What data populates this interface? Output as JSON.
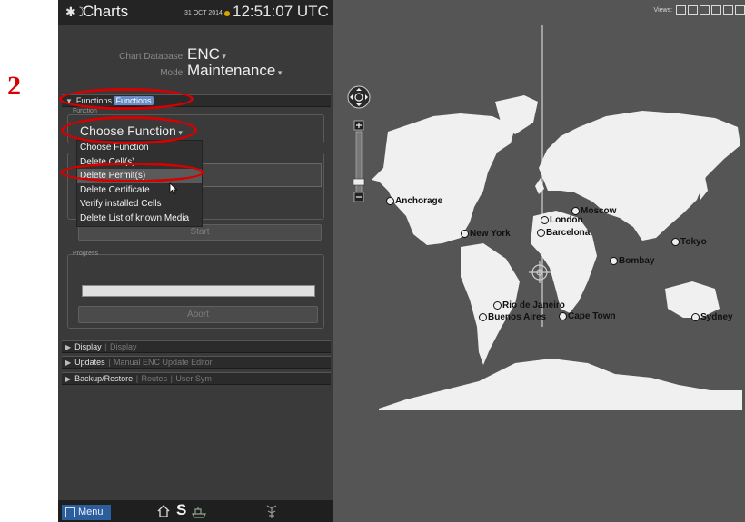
{
  "annotations": {
    "num2": "2",
    "num3": "3"
  },
  "header": {
    "title": "Charts",
    "date": "31 OCT 2014",
    "time": "12:51:07 UTC",
    "status_color": "#d7a400"
  },
  "settings": {
    "chart_database_label": "Chart Database:",
    "chart_database_value": "ENC",
    "mode_label": "Mode:",
    "mode_value": "Maintenance"
  },
  "sections": {
    "functions": {
      "label": "Functions",
      "sub": "Functions"
    },
    "display": {
      "label": "Display",
      "sub": "Display"
    },
    "updates": {
      "label": "Updates",
      "sub": "Manual ENC Update Editor"
    },
    "backup": {
      "label": "Backup/Restore",
      "sub1": "Routes",
      "sub2": "User Sym"
    }
  },
  "function_panel": {
    "group_label": "Function",
    "selected": "Choose Function",
    "options": [
      "Choose Function",
      "Delete Cell(s)",
      "Delete Permit(s)",
      "Delete Certificate",
      "Verify installed Cells",
      "Delete List of known Media"
    ],
    "highlighted_index": 2,
    "start_label": "Start",
    "progress_label": "Progress",
    "progress_value": 0,
    "abort_label": "Abort"
  },
  "bottom": {
    "menu_label": "Menu",
    "s_label": "S"
  },
  "map": {
    "views_label": "Views:",
    "cities": [
      "Anchorage",
      "New York",
      "London",
      "Moscow",
      "Barcelona",
      "Tokyo",
      "Bombay",
      "Rio de Janeiro",
      "Buenos Aires",
      "Cape Town",
      "Sydney"
    ],
    "land_color": "#f0f0f0",
    "sea_color": "#555555"
  },
  "colors": {
    "annotation_red": "#d60000",
    "menu_blue": "#2c5e9c",
    "tab_blue": "#6a8cc6"
  }
}
